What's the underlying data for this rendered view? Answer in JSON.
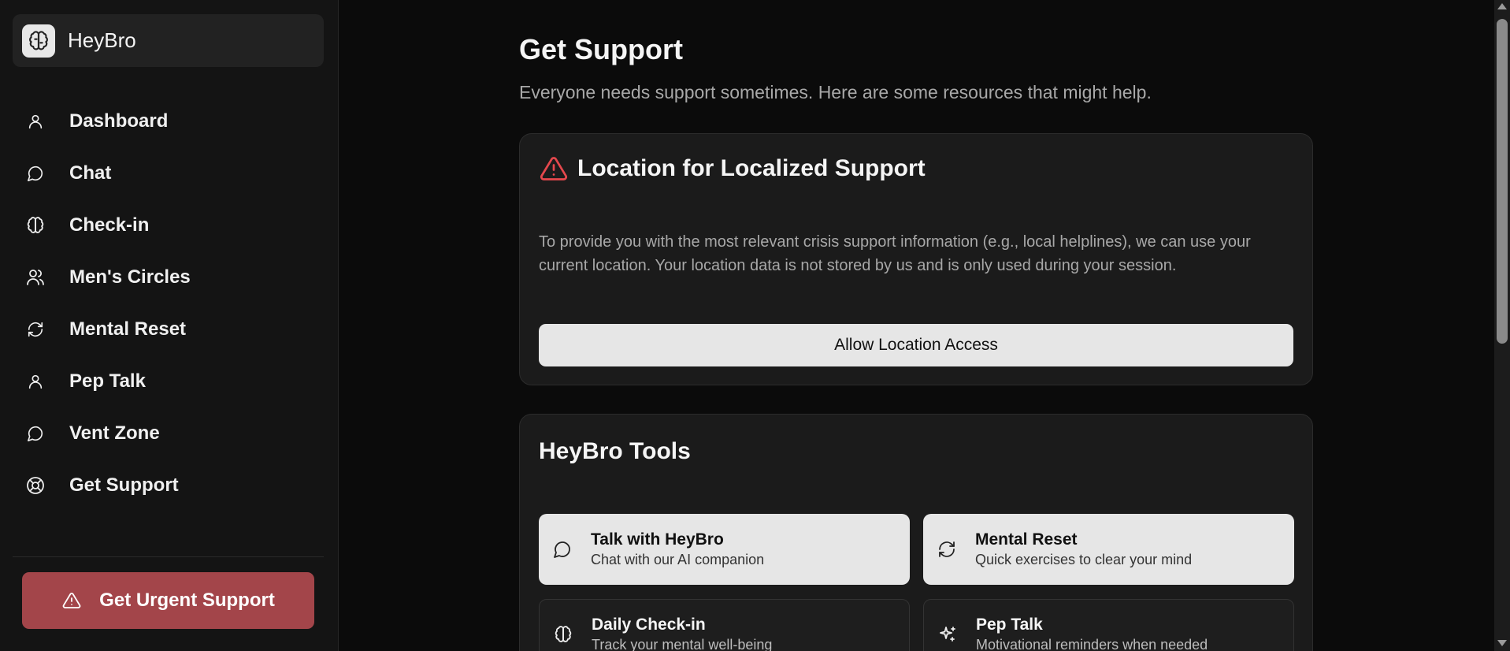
{
  "app": {
    "name": "HeyBro"
  },
  "sidebar": {
    "items": [
      {
        "label": "Dashboard",
        "icon": "user-icon"
      },
      {
        "label": "Chat",
        "icon": "message-circle-icon"
      },
      {
        "label": "Check-in",
        "icon": "brain-icon"
      },
      {
        "label": "Men's Circles",
        "icon": "users-icon"
      },
      {
        "label": "Mental Reset",
        "icon": "refresh-icon"
      },
      {
        "label": "Pep Talk",
        "icon": "user-icon"
      },
      {
        "label": "Vent Zone",
        "icon": "message-circle-icon"
      },
      {
        "label": "Get Support",
        "icon": "life-buoy-icon"
      }
    ],
    "urgent_label": "Get Urgent Support"
  },
  "main": {
    "title": "Get Support",
    "subtitle": "Everyone needs support sometimes. Here are some resources that might help.",
    "location_card": {
      "title": "Location for Localized Support",
      "description": "To provide you with the most relevant crisis support information (e.g., local helplines), we can use your current location. Your location data is not stored by us and is only used during your session.",
      "button_label": "Allow Location Access"
    },
    "tools_card": {
      "title": "HeyBro Tools",
      "tools": [
        {
          "title": "Talk with HeyBro",
          "description": "Chat with our AI companion",
          "icon": "message-circle-icon"
        },
        {
          "title": "Mental Reset",
          "description": "Quick exercises to clear your mind",
          "icon": "refresh-icon"
        },
        {
          "title": "Daily Check-in",
          "description": "Track your mental well-being",
          "icon": "brain-icon"
        },
        {
          "title": "Pep Talk",
          "description": "Motivational reminders when needed",
          "icon": "sparkles-icon"
        }
      ]
    }
  },
  "colors": {
    "background": "#0b0b0b",
    "sidebar": "#141414",
    "card": "#1b1b1b",
    "urgent": "#a3454a",
    "warning": "#e5484d",
    "button_light": "#e6e6e6"
  }
}
